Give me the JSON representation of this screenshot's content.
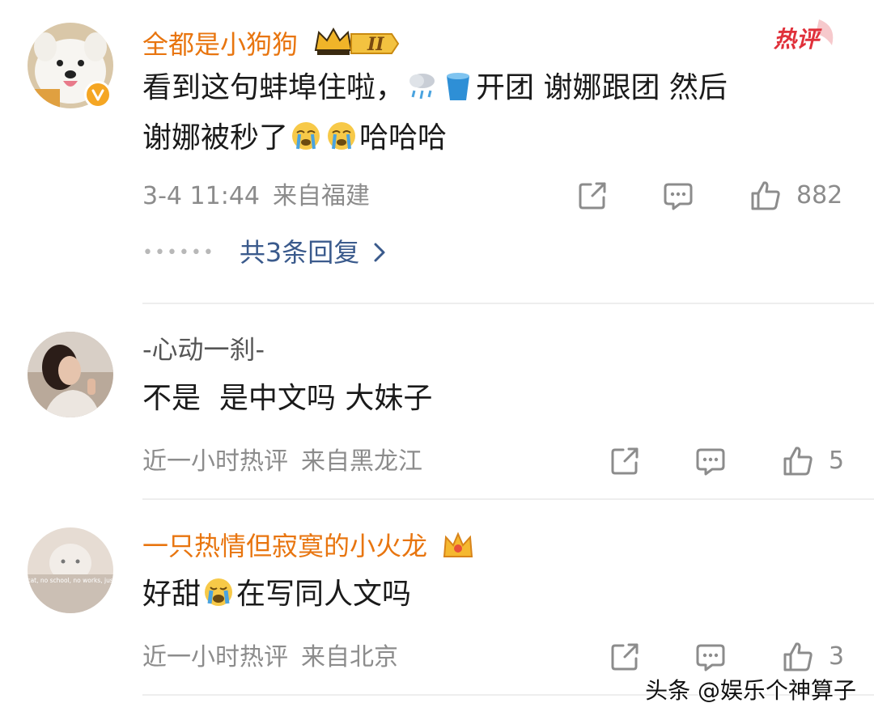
{
  "comments": [
    {
      "username": "全都是小狗狗",
      "text_line1": "看到这句蚌埠住啦，",
      "text_line1_after": "开团 谢娜跟团 然后",
      "text_line2": "谢娜被秒了",
      "text_line2_after": "哈哈哈",
      "time": "3-4 11:44",
      "location": "来自福建",
      "likes": "882",
      "replies_label": "共3条回复",
      "tag": "热评",
      "level": "II"
    },
    {
      "username": "-心动一刹-",
      "text": "不是  是中文吗 大妹子",
      "time": "近一小时热评",
      "location": "来自黑龙江",
      "likes": "5"
    },
    {
      "username": "一只热情但寂寞的小火龙",
      "text_before": "好甜",
      "text_after": "在写同人文吗",
      "time": "近一小时热评",
      "location": "来自北京",
      "likes": "3",
      "avatar_caption": "i wish i was a cat, no school, no works, just meow meow"
    }
  ],
  "watermark": "头条 @娱乐个神算子",
  "icons": {
    "share": "share-icon",
    "comment": "comment-icon",
    "like": "thumbs-up-icon",
    "verified": "verified-v-icon",
    "crown": "crown-icon",
    "rain": "rain-cloud-icon",
    "bucket": "bucket-icon",
    "crying": "crying-face-icon",
    "chevron": "chevron-right-icon"
  },
  "colors": {
    "vip_name": "#e8750f",
    "normal_name": "#555555",
    "meta": "#8c8c8c",
    "link": "#3a5a8c",
    "hot_tag": "#e0303a"
  }
}
